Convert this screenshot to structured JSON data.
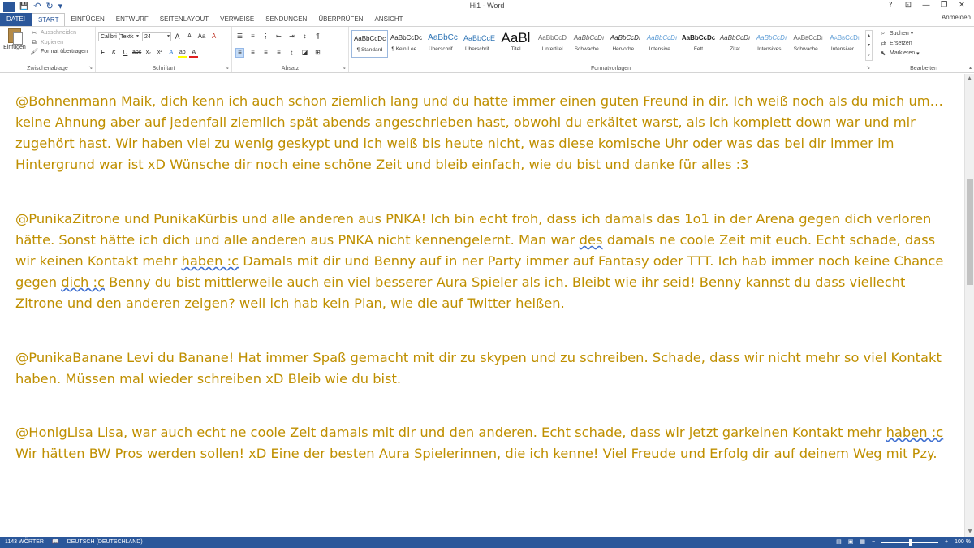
{
  "window": {
    "title": "Hi1 - Word",
    "sign_in": "Anmelden",
    "controls": {
      "help": "?",
      "ribbon_display": "⊡",
      "minimize": "—",
      "restore": "❐",
      "close": "✕"
    }
  },
  "quick_access": {
    "logo": "W",
    "save": "💾",
    "undo": "↶",
    "redo": "↻",
    "customize": "▾"
  },
  "tabs": {
    "file": "DATEI",
    "items": [
      "START",
      "EINFÜGEN",
      "ENTWURF",
      "SEITENLAYOUT",
      "VERWEISE",
      "SENDUNGEN",
      "ÜBERPRÜFEN",
      "ANSICHT"
    ],
    "active": "START"
  },
  "ribbon": {
    "clipboard": {
      "label": "Zwischenablage",
      "paste": "Einfügen",
      "cut": "Ausschneiden",
      "copy": "Kopieren",
      "format_painter": "Format übertragen"
    },
    "font": {
      "label": "Schriftart",
      "font_name": "Calibri (Textk",
      "font_size": "24",
      "grow": "A",
      "shrink": "A",
      "case": "Aa",
      "clear": "A",
      "bold": "F",
      "italic": "K",
      "underline": "U",
      "strike": "abc",
      "subscript": "x₂",
      "superscript": "x²",
      "text_effects": "A",
      "highlight": "ab",
      "font_color": "A"
    },
    "paragraph": {
      "label": "Absatz"
    },
    "styles": {
      "label": "Formatvorlagen",
      "items": [
        {
          "preview": "AaBbCcDc",
          "name": "¶ Standard"
        },
        {
          "preview": "AaBbCcDc",
          "name": "¶ Kein Lee..."
        },
        {
          "preview": "AaBbCc",
          "name": "Überschrif..."
        },
        {
          "preview": "AaBbCcE",
          "name": "Überschrif..."
        },
        {
          "preview": "AaBl",
          "name": "Titel"
        },
        {
          "preview": "AaBbCcD",
          "name": "Untertitel"
        },
        {
          "preview": "AaBbCcDı",
          "name": "Schwache..."
        },
        {
          "preview": "AaBbCcDı",
          "name": "Hervorhe..."
        },
        {
          "preview": "AaBbCcDı",
          "name": "Intensive..."
        },
        {
          "preview": "AaBbCcDc",
          "name": "Fett"
        },
        {
          "preview": "AaBbCcDı",
          "name": "Zitat"
        },
        {
          "preview": "AaBbCcDı",
          "name": "Intensives..."
        },
        {
          "preview": "AaBbCcDı",
          "name": "Schwache..."
        },
        {
          "preview": "AaBbCcDı",
          "name": "Intensiver..."
        }
      ]
    },
    "editing": {
      "label": "Bearbeiten",
      "find": "Suchen",
      "replace": "Ersetzen",
      "select": "Markieren"
    }
  },
  "document": {
    "paragraphs": [
      {
        "text": "@Bohnenmann Maik, dich kenn ich auch schon ziemlich lang und du hatte immer einen guten Freund in dir. Ich weiß noch als du mich um… keine Ahnung aber auf jedenfall ziemlich spät abends angeschrieben hast, obwohl du erkältet warst, als ich komplett down war und mir zugehört hast. Wir haben viel zu wenig geskypt und ich weiß bis heute nicht, was diese komische Uhr oder was das bei dir immer im Hintergrund war ist xD  Wünsche dir noch eine schöne Zeit und bleib einfach, wie du bist und danke für alles :3"
      },
      {
        "before1": "@PunikaZitrone und PunikaKürbis und alle anderen aus PNKA! Ich bin echt froh, dass ich damals das 1o1 in der Arena gegen dich verloren hätte. Sonst hätte ich dich und alle anderen aus PNKA nicht kennengelernt. Man war ",
        "flag1": "des",
        "before2": " damals ne coole Zeit mit euch. Echt schade, dass wir keinen Kontakt mehr ",
        "flag2": "haben :c",
        "before3": " Damals mit dir und Benny auf in ner Party immer auf Fantasy oder TTT. Ich hab immer noch keine Chance gegen ",
        "flag3": "dich :c",
        "after": " Benny du bist mittlerweile auch ein viel besserer Aura Spieler als ich. Bleibt wie ihr seid! Benny kannst du dass viellecht Zitrone und den anderen zeigen? weil ich hab kein Plan, wie die auf Twitter heißen."
      },
      {
        "text": "@PunikaBanane Levi du Banane! Hat immer Spaß gemacht mit dir zu skypen und zu schreiben. Schade, dass wir nicht mehr so viel Kontakt haben. Müssen mal wieder schreiben xD Bleib wie du bist."
      },
      {
        "before": "@HonigLisa Lisa, war auch echt ne coole Zeit damals mit dir und den anderen. Echt schade, dass wir jetzt garkeinen Kontakt mehr ",
        "flag": "haben :c",
        "after": " Wir hätten BW Pros werden sollen! xD Eine der besten Aura Spielerinnen, die ich kenne! Viel Freude und Erfolg dir auf deinem Weg mit Pzy."
      }
    ]
  },
  "status": {
    "words": "1143 WÖRTER",
    "language": "DEUTSCH (DEUTSCHLAND)",
    "zoom": "100 %",
    "zoom_minus": "−",
    "zoom_plus": "+"
  }
}
